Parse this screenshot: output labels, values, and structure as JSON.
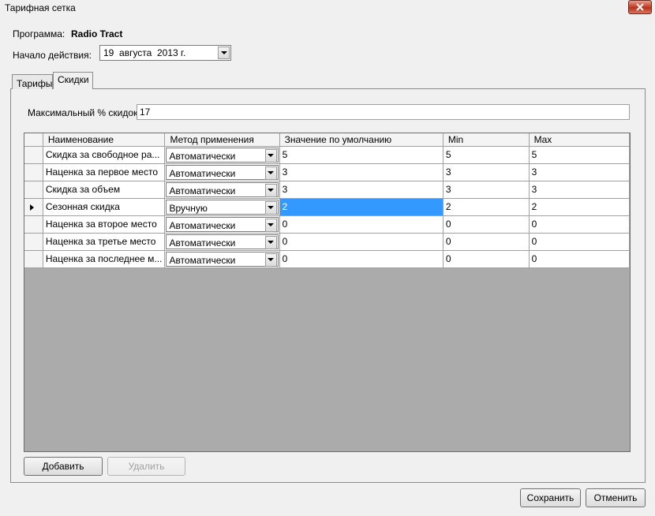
{
  "window": {
    "title": "Тарифная сетка"
  },
  "program": {
    "label": "Программа:",
    "value": "Radio Tract"
  },
  "start_date": {
    "label": "Начало действия:",
    "value": "19  августа  2013 г."
  },
  "tabs": [
    {
      "label": "Тарифы"
    },
    {
      "label": "Скидки"
    }
  ],
  "max_discount": {
    "label": "Максимальный % скидок:",
    "value": "17"
  },
  "table": {
    "headers": [
      "Наименование",
      "Метод применения",
      "Значение по умолчанию",
      "Min",
      "Max"
    ],
    "rows": [
      {
        "name": "Скидка за свободное ра...",
        "method": "Автоматически",
        "default": "5",
        "min": "5",
        "max": "5"
      },
      {
        "name": "Наценка за первое место",
        "method": "Автоматически",
        "default": "3",
        "min": "3",
        "max": "3"
      },
      {
        "name": "Скидка за объем",
        "method": "Автоматически",
        "default": "3",
        "min": "3",
        "max": "3"
      },
      {
        "name": "Сезонная скидка",
        "method": "Вручную",
        "default": "2",
        "min": "2",
        "max": "2"
      },
      {
        "name": "Наценка за второе место",
        "method": "Автоматически",
        "default": "0",
        "min": "0",
        "max": "0"
      },
      {
        "name": "Наценка за третье место",
        "method": "Автоматически",
        "default": "0",
        "min": "0",
        "max": "0"
      },
      {
        "name": "Наценка за последнее м...",
        "method": "Автоматически",
        "default": "0",
        "min": "0",
        "max": "0"
      }
    ]
  },
  "buttons": {
    "add": "Добавить",
    "delete": "Удалить",
    "save": "Сохранить",
    "cancel": "Отменить"
  },
  "colors": {
    "selection": "#3399ff",
    "grid_background": "#ababab",
    "close_button": "#c7452e"
  }
}
